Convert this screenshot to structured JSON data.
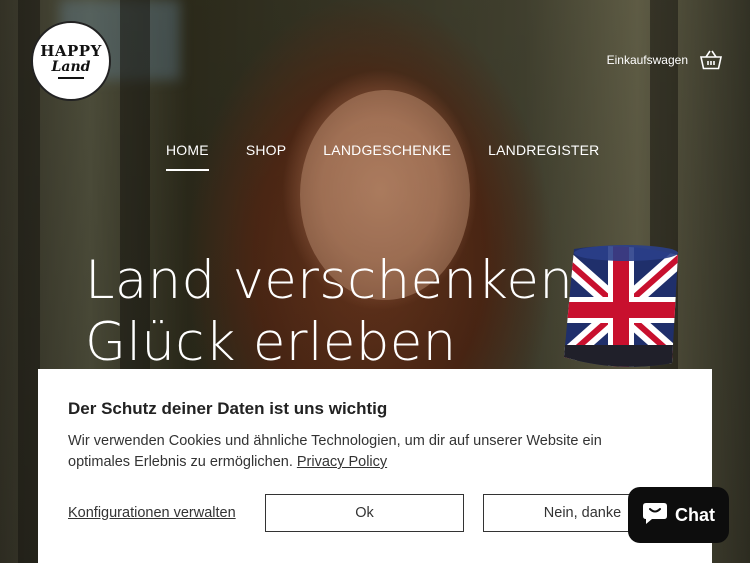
{
  "header": {
    "logo": {
      "line1": "HAPPY",
      "line2": "Land"
    },
    "cart_label": "Einkaufswagen",
    "cart_icon": "basket-icon"
  },
  "nav": {
    "items": [
      {
        "label": "HOME",
        "active": true
      },
      {
        "label": "SHOP",
        "active": false
      },
      {
        "label": "LANDGESCHENKE",
        "active": false
      },
      {
        "label": "LANDREGISTER",
        "active": false
      }
    ]
  },
  "hero": {
    "line1": "Land verschenken",
    "line2": "Glück erleben"
  },
  "cookie": {
    "title": "Der Schutz deiner Daten ist uns wichtig",
    "text": "Wir verwenden Cookies und ähnliche Technologien, um dir auf unserer Website ein optimales Erlebnis zu ermöglichen.",
    "policy_link": "Privacy Policy",
    "manage_label": "Konfigurationen verwalten",
    "ok_label": "Ok",
    "decline_label": "Nein, danke"
  },
  "chat": {
    "label": "Chat",
    "icon": "chat-bubble-icon"
  },
  "colors": {
    "accent": "#0d0d0d",
    "text": "#333333",
    "surface": "#ffffff"
  }
}
